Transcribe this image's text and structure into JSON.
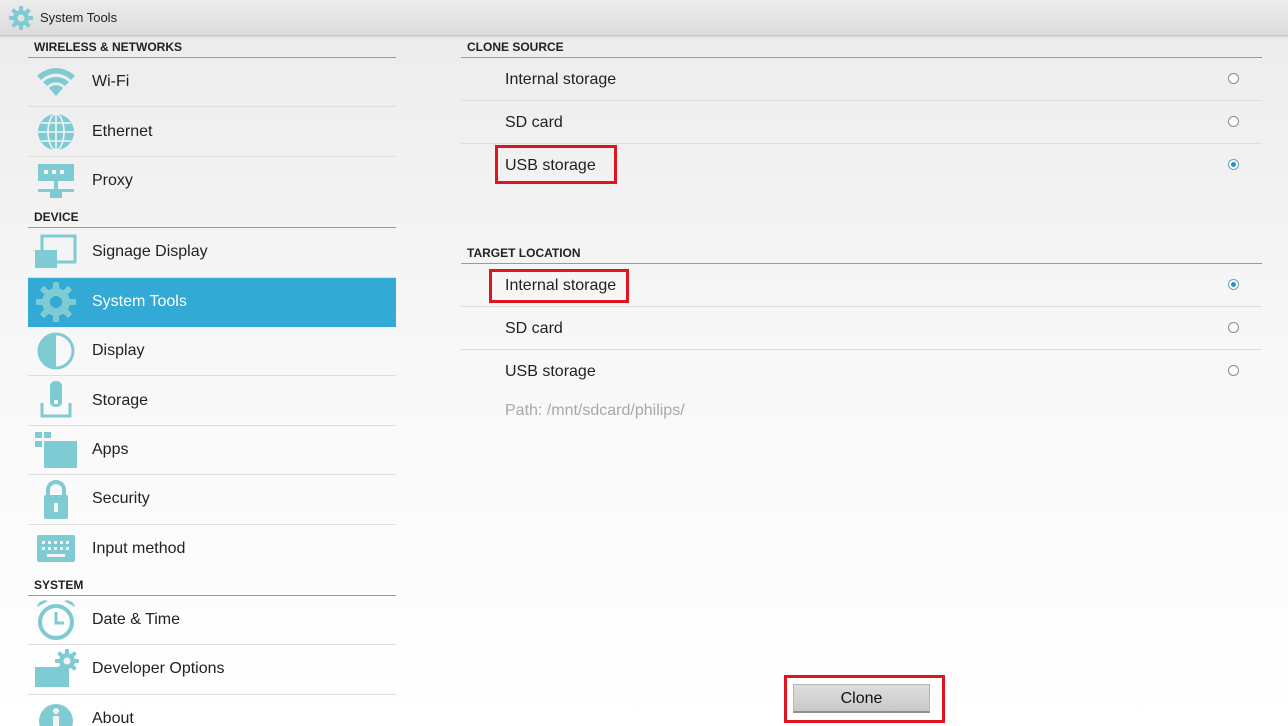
{
  "window": {
    "title": "System Tools",
    "title_icon": "gear-icon"
  },
  "sidebar": {
    "sections": [
      {
        "header": "WIRELESS & NETWORKS",
        "items": [
          {
            "label": "Wi-Fi",
            "icon": "wifi-icon"
          },
          {
            "label": "Ethernet",
            "icon": "globe-icon"
          },
          {
            "label": "Proxy",
            "icon": "proxy-icon"
          }
        ]
      },
      {
        "header": "DEVICE",
        "items": [
          {
            "label": "Signage Display",
            "icon": "display-cast-icon"
          },
          {
            "label": "System Tools",
            "icon": "gear-icon",
            "selected": true
          },
          {
            "label": "Display",
            "icon": "brightness-icon"
          },
          {
            "label": "Storage",
            "icon": "storage-icon"
          },
          {
            "label": "Apps",
            "icon": "apps-icon"
          },
          {
            "label": "Security",
            "icon": "lock-icon"
          },
          {
            "label": "Input method",
            "icon": "keyboard-icon"
          }
        ]
      },
      {
        "header": "SYSTEM",
        "items": [
          {
            "label": "Date & Time",
            "icon": "alarm-clock-icon"
          },
          {
            "label": "Developer Options",
            "icon": "developer-gear-icon"
          },
          {
            "label": "About",
            "icon": "info-icon"
          }
        ]
      }
    ],
    "accent_color": "#33a9d6",
    "icon_color": "#7fcbd3"
  },
  "clone_source": {
    "header": "CLONE SOURCE",
    "options": [
      {
        "label": "Internal storage",
        "selected": false
      },
      {
        "label": "SD card",
        "selected": false
      },
      {
        "label": "USB storage",
        "selected": true
      }
    ]
  },
  "target_location": {
    "header": "TARGET LOCATION",
    "options": [
      {
        "label": "Internal storage",
        "selected": true
      },
      {
        "label": "SD card",
        "selected": false
      },
      {
        "label": "USB storage",
        "selected": false
      }
    ],
    "path": "Path: /mnt/sdcard/philips/"
  },
  "actions": {
    "clone_label": "Clone"
  },
  "highlight_color": "#e0141e"
}
